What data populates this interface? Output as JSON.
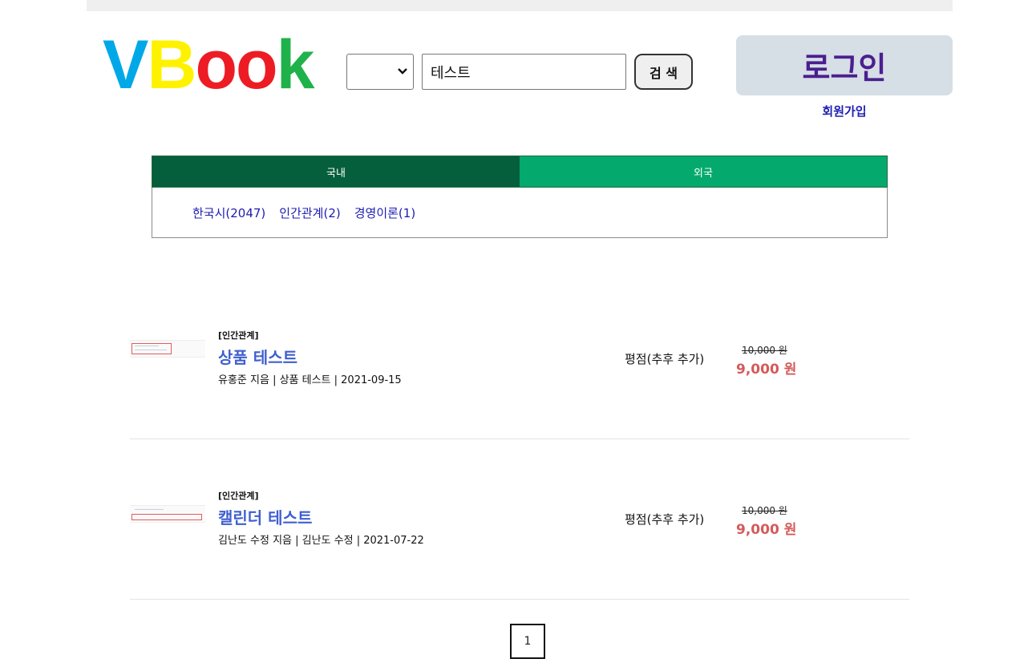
{
  "header": {
    "logo": {
      "letters": [
        "V",
        "B",
        "o",
        "o",
        "k"
      ],
      "colors": [
        "#00a8e8",
        "#fff200",
        "#ed1c24",
        "#ed1c24",
        "#1fb24a"
      ]
    },
    "search": {
      "category_selected": "",
      "query": "테스트",
      "button_label": "검 색"
    },
    "login_label": "로그인",
    "signup_label": "회원가입"
  },
  "tabs": [
    {
      "label": "국내",
      "color": "#055f3c"
    },
    {
      "label": "외국",
      "color": "#04aa6d"
    }
  ],
  "categories": [
    "한국시(2047)",
    "인간관계(2)",
    "경영이론(1)"
  ],
  "products": [
    {
      "category": "[인간관계]",
      "title": "상품 테스트",
      "meta": "유홍준 지음 | 상품 테스트 | 2021-09-15",
      "rating": "평점(추후 추가)",
      "original_price": "10,000 원",
      "sale_price": "9,000 원"
    },
    {
      "category": "[인간관계]",
      "title": "캘린더 테스트",
      "meta": "김난도 수정 지음 | 김난도 수정 | 2021-07-22",
      "rating": "평점(추후 추가)",
      "original_price": "10,000 원",
      "sale_price": "9,000 원"
    }
  ],
  "pagination": {
    "current_page": "1"
  },
  "colors": {
    "title_link": "#3f5fd0",
    "sale_price": "#d55a5a",
    "category_link": "#1c1cb3",
    "login_text": "#4b1f8f",
    "login_bg": "#d6dee6"
  }
}
